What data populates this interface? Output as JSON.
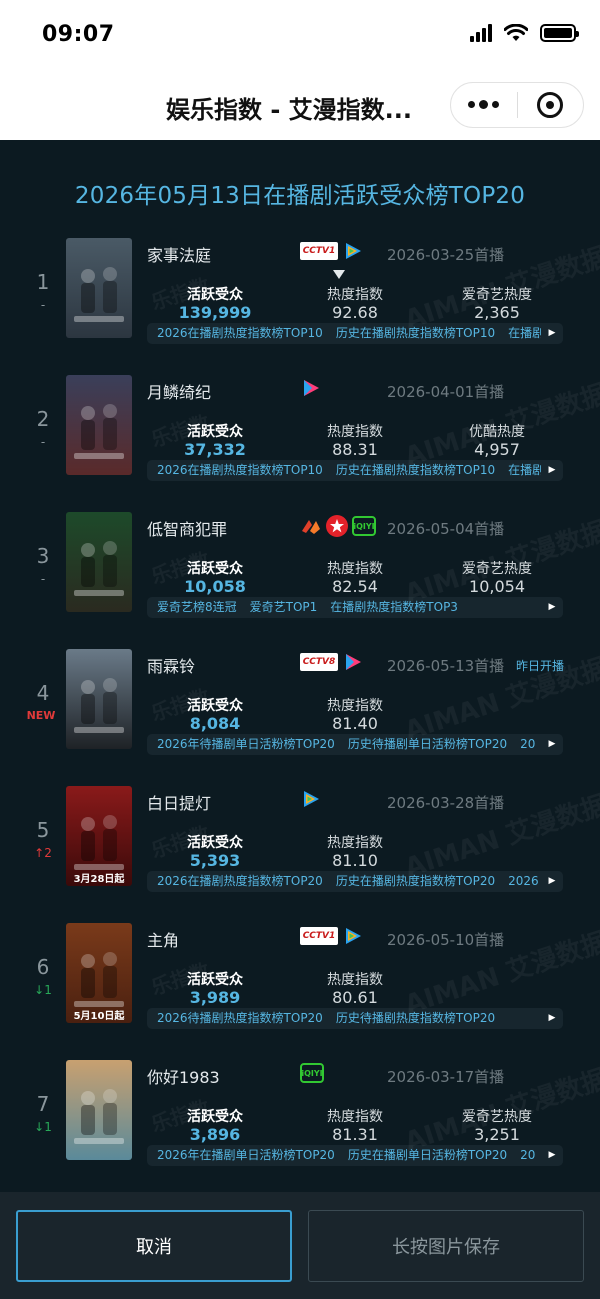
{
  "status_bar": {
    "time": "09:07"
  },
  "nav": {
    "title": "娱乐指数 - 艾漫指数..."
  },
  "board": {
    "title": "2026年05月13日在播剧活跃受众榜TOP20",
    "watermark_brand": "AIMAN 艾漫数据",
    "watermark_slogan": "乐指数",
    "entries": [
      {
        "rank": "1",
        "change": "-",
        "name": "家事法庭",
        "platforms": [
          "cctv1-logo",
          "tencent-video-logo"
        ],
        "date": "2026-03-25首播",
        "tag": "",
        "active_label": "活跃受众",
        "active_value": "139,999",
        "heat_label": "热度指数",
        "heat_value": "92.68",
        "extra_label": "爱奇艺热度",
        "extra_value": "2,365",
        "badges": [
          "2026在播剧热度指数榜TOP10",
          "历史在播剧热度指数榜TOP10",
          "在播剧"
        ],
        "poster_colors": [
          "#4a5a66",
          "#2c3640"
        ]
      },
      {
        "rank": "2",
        "change": "-",
        "name": "月鳞绮纪",
        "platforms": [
          "youku-logo"
        ],
        "date": "2026-04-01首播",
        "tag": "",
        "active_label": "活跃受众",
        "active_value": "37,332",
        "heat_label": "热度指数",
        "heat_value": "88.31",
        "extra_label": "优酷热度",
        "extra_value": "4,957",
        "badges": [
          "2026在播剧热度指数榜TOP10",
          "历史在播剧热度指数榜TOP10",
          "在播剧"
        ],
        "poster_colors": [
          "#3a3f5a",
          "#5a2a2a"
        ]
      },
      {
        "rank": "3",
        "change": "-",
        "name": "低智商犯罪",
        "platforms": [
          "mango-logo",
          "dragon-tv-logo",
          "iqiyi-logo"
        ],
        "date": "2026-05-04首播",
        "tag": "",
        "active_label": "活跃受众",
        "active_value": "10,058",
        "heat_label": "热度指数",
        "heat_value": "82.54",
        "extra_label": "爱奇艺热度",
        "extra_value": "10,054",
        "badges": [
          "爱奇艺榜8连冠",
          "爱奇艺TOP1",
          "在播剧热度指数榜TOP3"
        ],
        "poster_colors": [
          "#1d4a2a",
          "#2a2a20"
        ]
      },
      {
        "rank": "4",
        "change": "NEW",
        "name": "雨霖铃",
        "platforms": [
          "cctv8-logo",
          "youku-logo"
        ],
        "date": "2026-05-13首播",
        "tag": "昨日开播",
        "active_label": "活跃受众",
        "active_value": "8,084",
        "heat_label": "热度指数",
        "heat_value": "81.40",
        "extra_label": "",
        "extra_value": "",
        "badges": [
          "2026年待播剧单日活粉榜TOP20",
          "历史待播剧单日活粉榜TOP20",
          "20"
        ],
        "poster_colors": [
          "#6a7a88",
          "#1e2226"
        ]
      },
      {
        "rank": "5",
        "change": "↑2",
        "name": "白日提灯",
        "platforms": [
          "tencent-video-logo"
        ],
        "date": "2026-03-28首播",
        "tag": "",
        "active_label": "活跃受众",
        "active_value": "5,393",
        "heat_label": "热度指数",
        "heat_value": "81.10",
        "extra_label": "",
        "extra_value": "",
        "badges": [
          "2026在播剧热度指数榜TOP20",
          "历史在播剧热度指数榜TOP20",
          "2026"
        ],
        "poster_caption": "3月28日起",
        "poster_colors": [
          "#8a1a1a",
          "#3a0a0a"
        ]
      },
      {
        "rank": "6",
        "change": "↓1",
        "name": "主角",
        "platforms": [
          "cctv1-logo",
          "tencent-video-logo"
        ],
        "date": "2026-05-10首播",
        "tag": "",
        "active_label": "活跃受众",
        "active_value": "3,989",
        "heat_label": "热度指数",
        "heat_value": "80.61",
        "extra_label": "",
        "extra_value": "",
        "badges": [
          "2026待播剧热度指数榜TOP20",
          "历史待播剧热度指数榜TOP20"
        ],
        "poster_caption": "5月10日起",
        "poster_colors": [
          "#7a3a1a",
          "#4a2010"
        ]
      },
      {
        "rank": "7",
        "change": "↓1",
        "name": "你好1983",
        "platforms": [
          "iqiyi-logo"
        ],
        "date": "2026-03-17首播",
        "tag": "",
        "active_label": "活跃受众",
        "active_value": "3,896",
        "heat_label": "热度指数",
        "heat_value": "81.31",
        "extra_label": "爱奇艺热度",
        "extra_value": "3,251",
        "badges": [
          "2026年在播剧单日活粉榜TOP20",
          "历史在播剧单日活粉榜TOP20",
          "20"
        ],
        "poster_colors": [
          "#c8a070",
          "#5a8a9a"
        ]
      }
    ]
  },
  "buttons": {
    "cancel": "取消",
    "save": "长按图片保存"
  },
  "logo_text": {
    "cctv1": "CCTV1",
    "cctv8": "CCTV8",
    "iqiyi": "iQIYI"
  },
  "colors": {
    "background": "#0c1a21",
    "accent": "#56b6e2",
    "up": "#e03a3a",
    "down": "#28a858"
  }
}
